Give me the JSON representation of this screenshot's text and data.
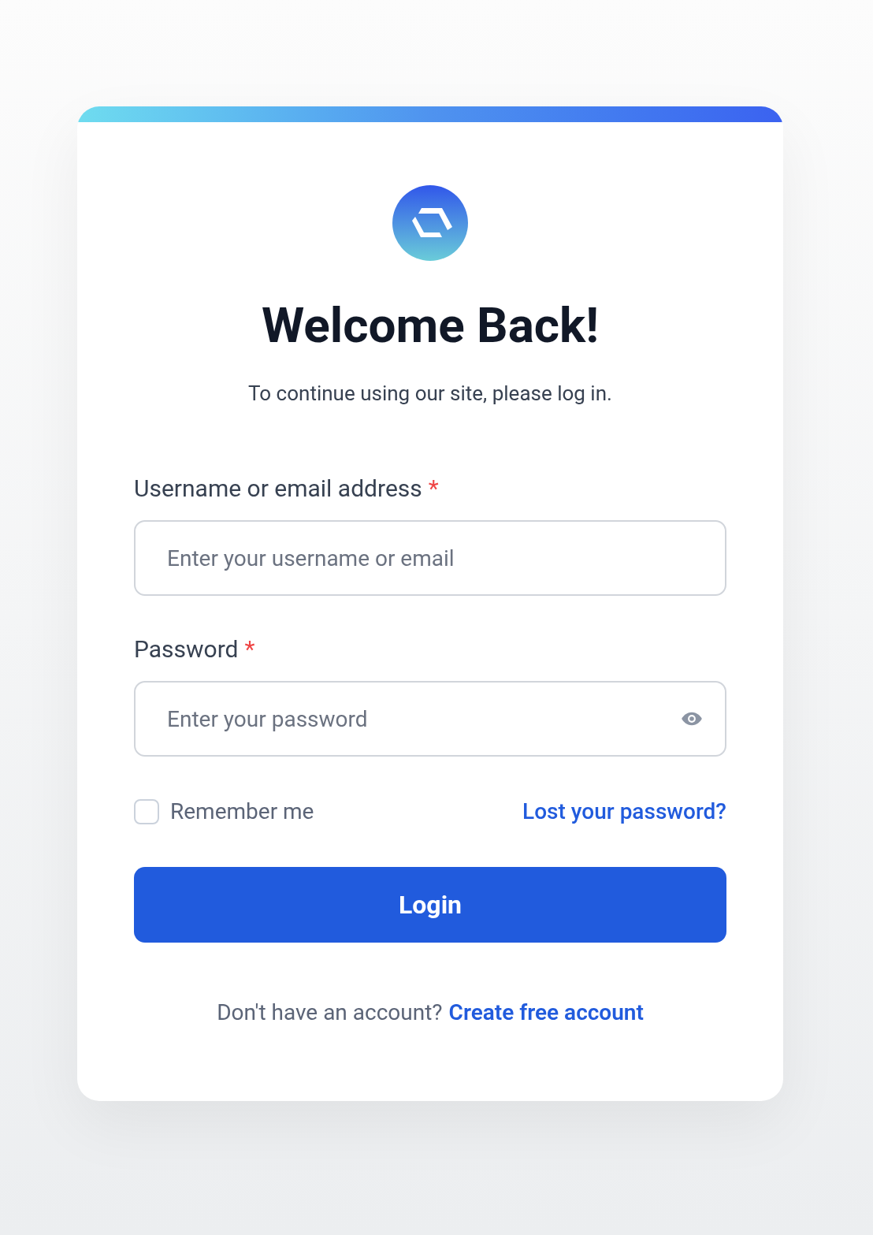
{
  "title": "Welcome Back!",
  "subtitle": "To continue using our site, please log in.",
  "fields": [
    {
      "label": "Username or email address",
      "required_mark": "*",
      "placeholder": "Enter your username or email",
      "kind": "text"
    },
    {
      "label": "Password",
      "required_mark": "*",
      "placeholder": "Enter your password",
      "kind": "password"
    }
  ],
  "remember": {
    "label": "Remember me",
    "checked": false
  },
  "lost_password": "Lost your password?",
  "login_button": "Login",
  "footer": {
    "text": "Don't have an account?",
    "link": "Create free account"
  }
}
